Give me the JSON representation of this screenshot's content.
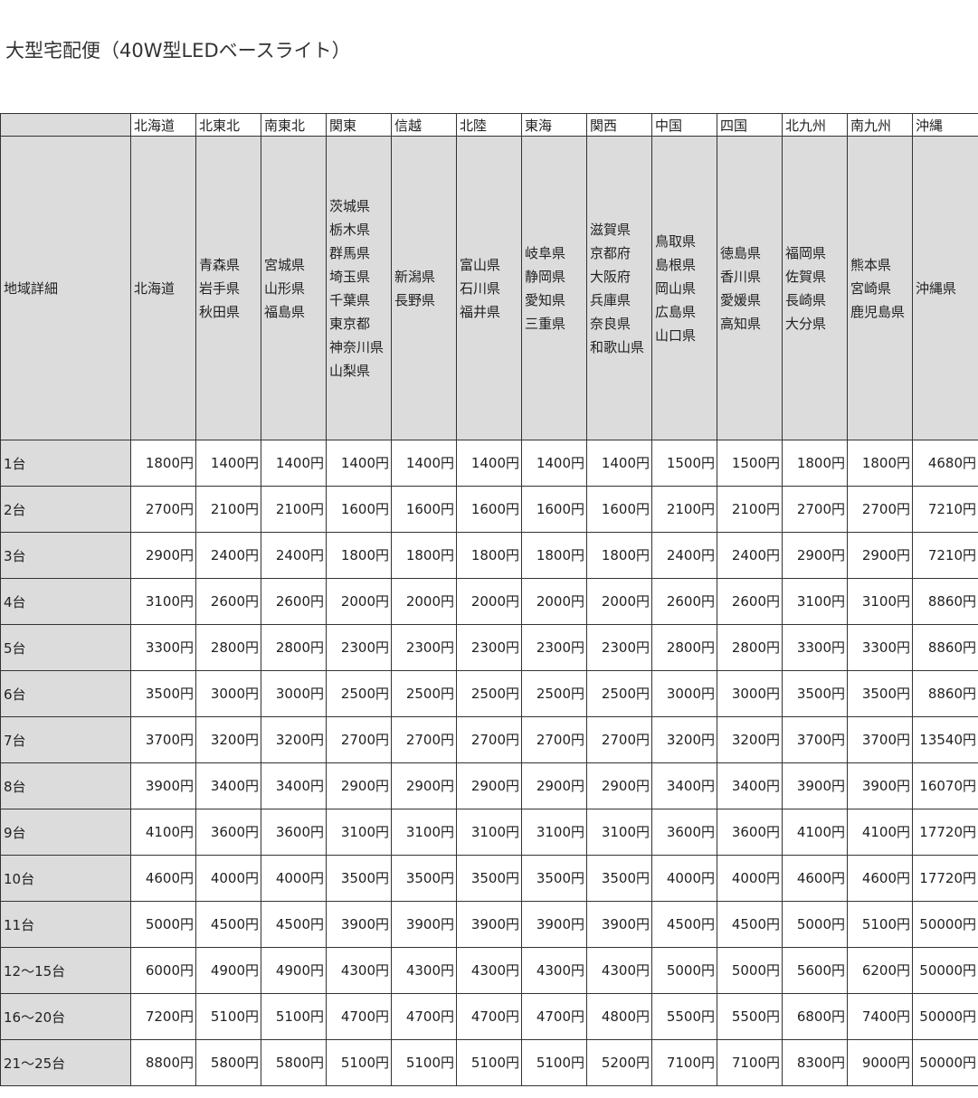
{
  "title": "大型宅配便（40W型LEDベースライト）",
  "table": {
    "regions": [
      "北海道",
      "北東北",
      "南東北",
      "関東",
      "信越",
      "北陸",
      "東海",
      "関西",
      "中国",
      "四国",
      "北九州",
      "南九州",
      "沖縄"
    ],
    "detail_label": "地域詳細",
    "prefectures": [
      [
        "北海道"
      ],
      [
        "青森県",
        "岩手県",
        "秋田県"
      ],
      [
        "宮城県",
        "山形県",
        "福島県"
      ],
      [
        "茨城県",
        "栃木県",
        "群馬県",
        "埼玉県",
        "千葉県",
        "東京都",
        "神奈川県",
        "山梨県"
      ],
      [
        "新潟県",
        "長野県"
      ],
      [
        "富山県",
        "石川県",
        "福井県"
      ],
      [
        "岐阜県",
        "静岡県",
        "愛知県",
        "三重県"
      ],
      [
        "滋賀県",
        "京都府",
        "大阪府",
        "兵庫県",
        "奈良県",
        "和歌山県"
      ],
      [
        "鳥取県",
        "島根県",
        "岡山県",
        "広島県",
        "山口県"
      ],
      [
        "徳島県",
        "香川県",
        "愛媛県",
        "高知県"
      ],
      [
        "福岡県",
        "佐賀県",
        "長崎県",
        "大分県"
      ],
      [
        "熊本県",
        "宮崎県",
        "鹿児島県"
      ],
      [
        "沖縄県"
      ]
    ],
    "rows": [
      {
        "qty": "1台",
        "prices": [
          "1800円",
          "1400円",
          "1400円",
          "1400円",
          "1400円",
          "1400円",
          "1400円",
          "1400円",
          "1500円",
          "1500円",
          "1800円",
          "1800円",
          "4680円"
        ]
      },
      {
        "qty": "2台",
        "prices": [
          "2700円",
          "2100円",
          "2100円",
          "1600円",
          "1600円",
          "1600円",
          "1600円",
          "1600円",
          "2100円",
          "2100円",
          "2700円",
          "2700円",
          "7210円"
        ]
      },
      {
        "qty": "3台",
        "prices": [
          "2900円",
          "2400円",
          "2400円",
          "1800円",
          "1800円",
          "1800円",
          "1800円",
          "1800円",
          "2400円",
          "2400円",
          "2900円",
          "2900円",
          "7210円"
        ]
      },
      {
        "qty": "4台",
        "prices": [
          "3100円",
          "2600円",
          "2600円",
          "2000円",
          "2000円",
          "2000円",
          "2000円",
          "2000円",
          "2600円",
          "2600円",
          "3100円",
          "3100円",
          "8860円"
        ]
      },
      {
        "qty": "5台",
        "prices": [
          "3300円",
          "2800円",
          "2800円",
          "2300円",
          "2300円",
          "2300円",
          "2300円",
          "2300円",
          "2800円",
          "2800円",
          "3300円",
          "3300円",
          "8860円"
        ]
      },
      {
        "qty": "6台",
        "prices": [
          "3500円",
          "3000円",
          "3000円",
          "2500円",
          "2500円",
          "2500円",
          "2500円",
          "2500円",
          "3000円",
          "3000円",
          "3500円",
          "3500円",
          "8860円"
        ]
      },
      {
        "qty": "7台",
        "prices": [
          "3700円",
          "3200円",
          "3200円",
          "2700円",
          "2700円",
          "2700円",
          "2700円",
          "2700円",
          "3200円",
          "3200円",
          "3700円",
          "3700円",
          "13540円"
        ]
      },
      {
        "qty": "8台",
        "prices": [
          "3900円",
          "3400円",
          "3400円",
          "2900円",
          "2900円",
          "2900円",
          "2900円",
          "2900円",
          "3400円",
          "3400円",
          "3900円",
          "3900円",
          "16070円"
        ]
      },
      {
        "qty": "9台",
        "prices": [
          "4100円",
          "3600円",
          "3600円",
          "3100円",
          "3100円",
          "3100円",
          "3100円",
          "3100円",
          "3600円",
          "3600円",
          "4100円",
          "4100円",
          "17720円"
        ]
      },
      {
        "qty": "10台",
        "prices": [
          "4600円",
          "4000円",
          "4000円",
          "3500円",
          "3500円",
          "3500円",
          "3500円",
          "3500円",
          "4000円",
          "4000円",
          "4600円",
          "4600円",
          "17720円"
        ]
      },
      {
        "qty": "11台",
        "prices": [
          "5000円",
          "4500円",
          "4500円",
          "3900円",
          "3900円",
          "3900円",
          "3900円",
          "3900円",
          "4500円",
          "4500円",
          "5000円",
          "5100円",
          "50000円"
        ]
      },
      {
        "qty": "12～15台",
        "prices": [
          "6000円",
          "4900円",
          "4900円",
          "4300円",
          "4300円",
          "4300円",
          "4300円",
          "4300円",
          "5000円",
          "5000円",
          "5600円",
          "6200円",
          "50000円"
        ]
      },
      {
        "qty": "16～20台",
        "prices": [
          "7200円",
          "5100円",
          "5100円",
          "4700円",
          "4700円",
          "4700円",
          "4700円",
          "4800円",
          "5500円",
          "5500円",
          "6800円",
          "7400円",
          "50000円"
        ]
      },
      {
        "qty": "21～25台",
        "prices": [
          "8800円",
          "5800円",
          "5800円",
          "5100円",
          "5100円",
          "5100円",
          "5100円",
          "5200円",
          "7100円",
          "7100円",
          "8300円",
          "9000円",
          "50000円"
        ]
      }
    ]
  }
}
